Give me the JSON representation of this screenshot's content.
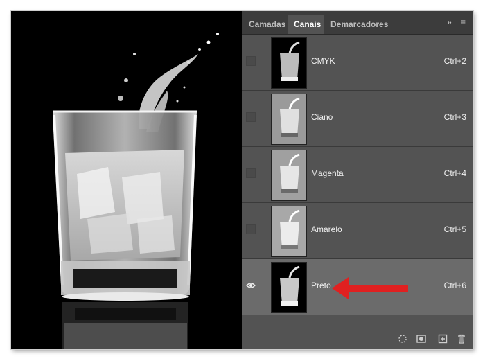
{
  "panel": {
    "tabs": [
      {
        "label": "Camadas",
        "active": false
      },
      {
        "label": "Canais",
        "active": true
      },
      {
        "label": "Demarcadores",
        "active": false
      }
    ],
    "collapse_glyph": "»",
    "menu_glyph": "≡",
    "channels": [
      {
        "name": "CMYK",
        "shortcut": "Ctrl+2",
        "visible": false,
        "selected": false,
        "thumb_tone": "dark"
      },
      {
        "name": "Ciano",
        "shortcut": "Ctrl+3",
        "visible": false,
        "selected": false,
        "thumb_tone": "light"
      },
      {
        "name": "Magenta",
        "shortcut": "Ctrl+4",
        "visible": false,
        "selected": false,
        "thumb_tone": "light"
      },
      {
        "name": "Amarelo",
        "shortcut": "Ctrl+5",
        "visible": false,
        "selected": false,
        "thumb_tone": "light"
      },
      {
        "name": "Preto",
        "shortcut": "Ctrl+6",
        "visible": true,
        "selected": true,
        "thumb_tone": "dark"
      }
    ],
    "bottom_icons": [
      "load-channel-as-selection-icon",
      "save-selection-as-channel-icon",
      "new-channel-icon",
      "delete-channel-icon"
    ]
  },
  "annotation": {
    "arrow_color": "#e02020",
    "target": "Preto"
  }
}
